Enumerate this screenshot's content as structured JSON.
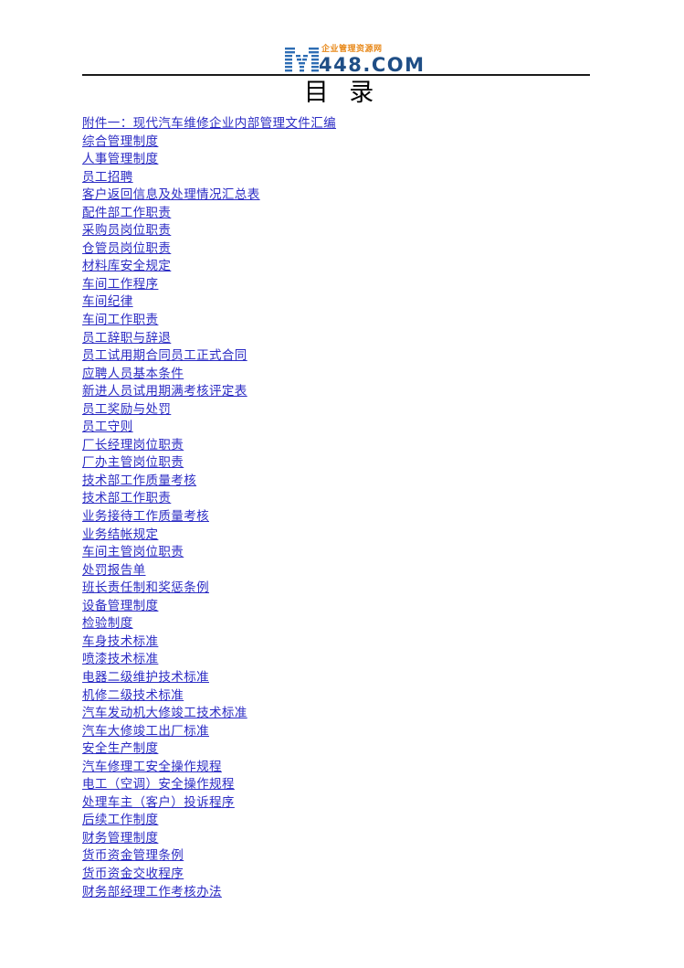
{
  "document": {
    "title": "目 录",
    "logo": {
      "mark_letter": "M",
      "tagline": "企业管理资源网",
      "domain": "448.COM",
      "tagline_color": "#E8891A",
      "domain_color": "#1F4E86",
      "mark_color": "#2E6DB4"
    },
    "link_color": "#2B2BC4",
    "toc": {
      "items": [
        {
          "label": "附件一：现代汽车维修企业内部管理文件汇编"
        },
        {
          "label": "综合管理制度"
        },
        {
          "label": "人事管理制度"
        },
        {
          "label": "员工招聘"
        },
        {
          "label": "客户返回信息及处理情况汇总表"
        },
        {
          "label": "配件部工作职责"
        },
        {
          "label": "采购员岗位职责"
        },
        {
          "label": "仓管员岗位职责"
        },
        {
          "label": "材料库安全规定"
        },
        {
          "label": "车间工作程序"
        },
        {
          "label": "车间纪律"
        },
        {
          "label": "车间工作职责"
        },
        {
          "label": "员工辞职与辞退"
        },
        {
          "label": "员工试用期合同员工正式合同"
        },
        {
          "label": "应聘人员基本条件"
        },
        {
          "label": "新进人员试用期满考核评定表"
        },
        {
          "label": "员工奖励与处罚"
        },
        {
          "label": "员工守则"
        },
        {
          "label": "厂长经理岗位职责"
        },
        {
          "label": "厂办主管岗位职责"
        },
        {
          "label": "技术部工作质量考核"
        },
        {
          "label": "技术部工作职责"
        },
        {
          "label": "业务接待工作质量考核"
        },
        {
          "label": "业务结帐规定"
        },
        {
          "label": "车间主管岗位职责"
        },
        {
          "label": "处罚报告单"
        },
        {
          "label": "班长责任制和奖惩条例"
        },
        {
          "label": "设备管理制度"
        },
        {
          "label": "检验制度"
        },
        {
          "label": "车身技术标准"
        },
        {
          "label": "喷漆技术标准"
        },
        {
          "label": "电器二级维护技术标准"
        },
        {
          "label": "机修二级技术标准"
        },
        {
          "label": "汽车发动机大修竣工技术标准"
        },
        {
          "label": "汽车大修竣工出厂标准"
        },
        {
          "label": "安全生产制度"
        },
        {
          "label": "汽车修理工安全操作规程"
        },
        {
          "label": "电工（空调）安全操作规程"
        },
        {
          "label": "处理车主（客户）投诉程序"
        },
        {
          "label": "后续工作制度"
        },
        {
          "label": "财务管理制度"
        },
        {
          "label": "货币资金管理条例"
        },
        {
          "label": "货币资金交收程序"
        },
        {
          "label": "财务部经理工作考核办法"
        }
      ]
    }
  }
}
